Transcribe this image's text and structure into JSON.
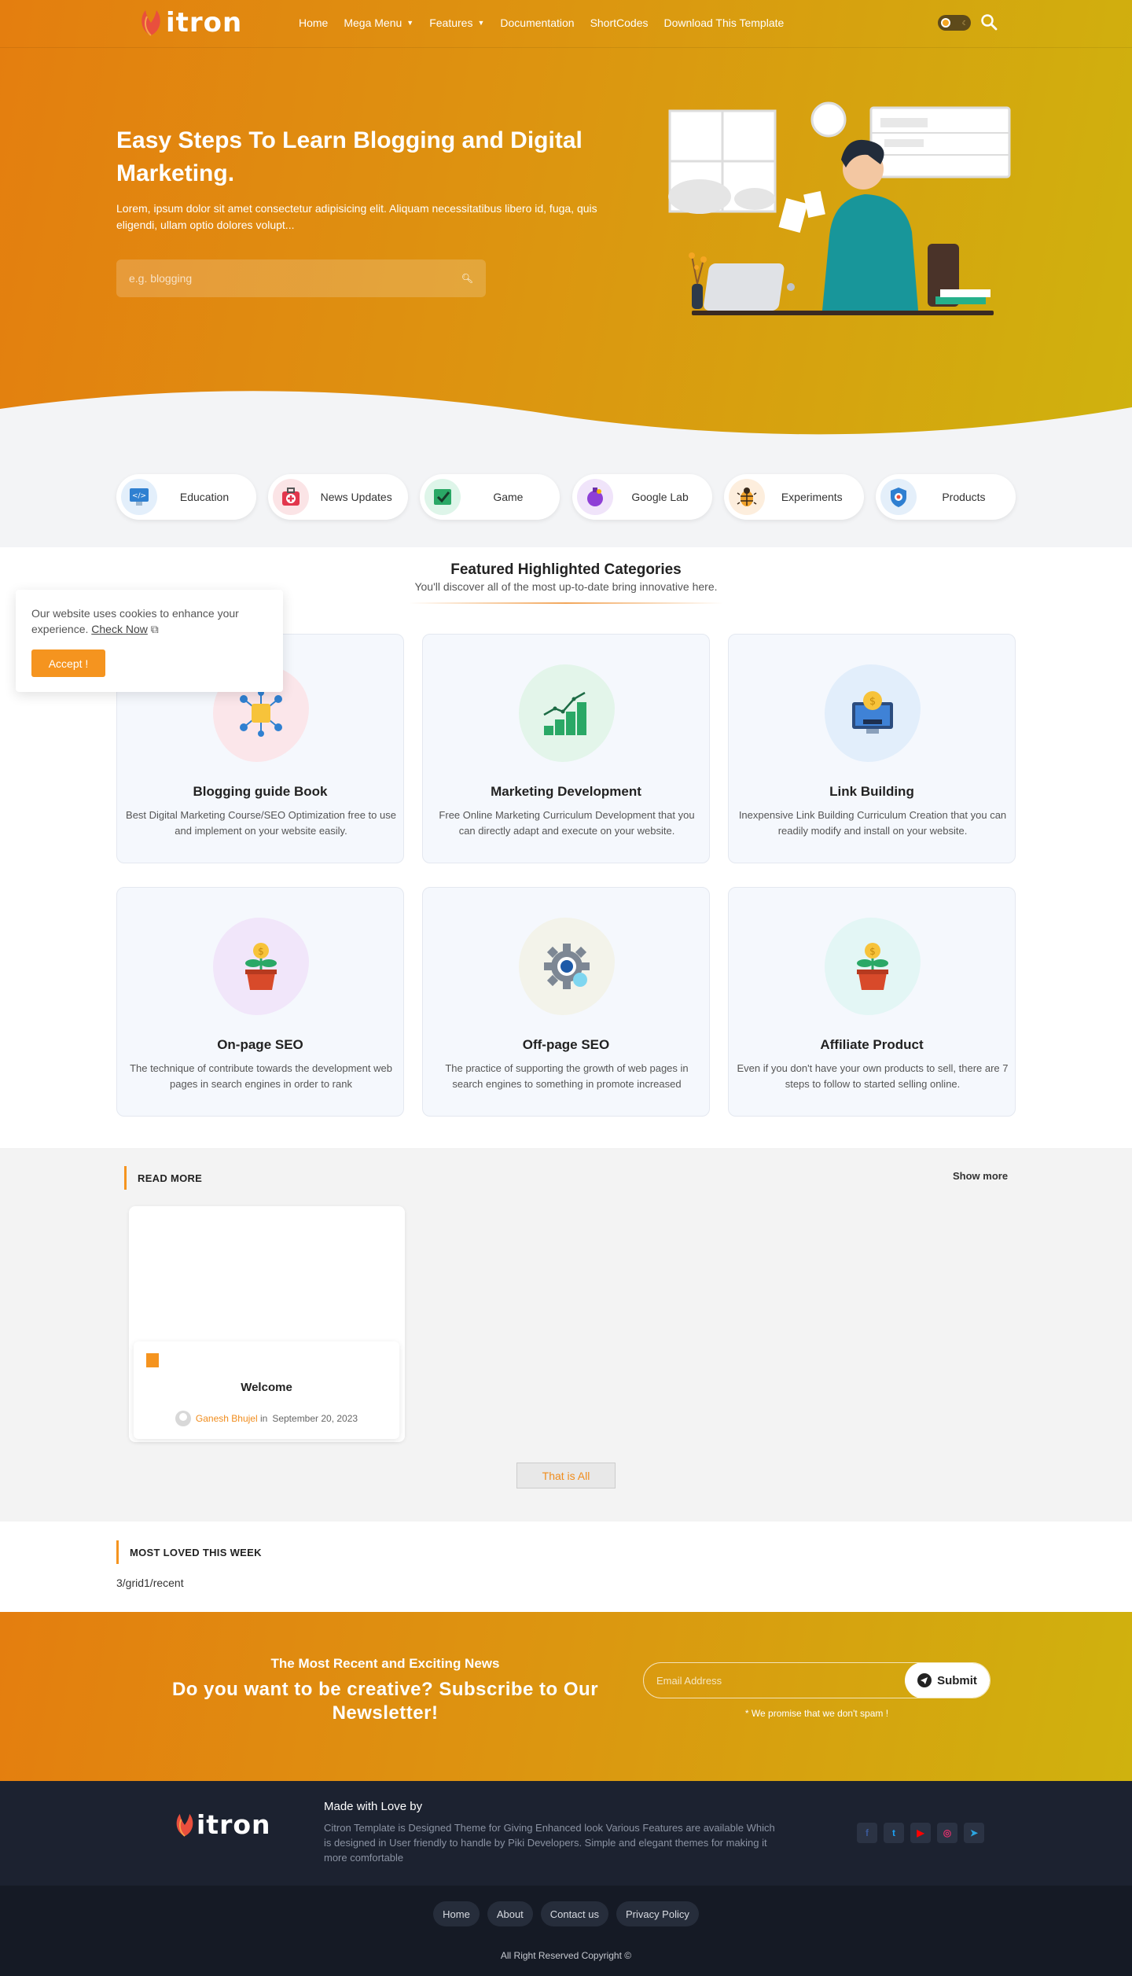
{
  "colors": {
    "accent": "#f5941f",
    "gradient_start": "#e47e0f",
    "gradient_end": "#cfb20e",
    "footer_bg": "#1c2230",
    "footer_bottom_bg": "#151a25"
  },
  "header": {
    "logo_text": "itron",
    "nav": [
      {
        "label": "Home"
      },
      {
        "label": "Mega Menu",
        "icon": "chevron-down-icon"
      },
      {
        "label": "Features",
        "icon": "chevron-down-icon"
      },
      {
        "label": "Documentation"
      },
      {
        "label": "ShortCodes"
      },
      {
        "label": "Download This Template"
      }
    ],
    "theme_toggle_icon": "sun-moon-toggle-icon",
    "search_icon": "search-icon"
  },
  "hero": {
    "title": "Easy Steps To Learn Blogging and Digital Marketing.",
    "description": "Lorem, ipsum dolor sit amet consectetur adipisicing elit. Aliquam necessitatibus libero id, fuga, quis eligendi, ullam optio dolores volupt...",
    "search_placeholder": "e.g. blogging",
    "search_icon": "search-icon"
  },
  "categories": [
    {
      "label": "Education",
      "icon": "code-monitor-icon"
    },
    {
      "label": "News Updates",
      "icon": "first-aid-kit-icon"
    },
    {
      "label": "Game",
      "icon": "checkbox-icon"
    },
    {
      "label": "Google Lab",
      "icon": "potion-flask-icon"
    },
    {
      "label": "Experiments",
      "icon": "bug-icon"
    },
    {
      "label": "Products",
      "icon": "shield-icon"
    }
  ],
  "featured": {
    "title": "Featured Highlighted Categories",
    "subtitle": "You'll discover all of the most up-to-date bring innovative here.",
    "cards": [
      {
        "title": "Blogging guide Book",
        "description": "Best Digital Marketing Course/SEO Optimization free to use and implement on your website easily.",
        "icon": "network-box-icon",
        "blob": "#fbe6ea"
      },
      {
        "title": "Marketing Development",
        "description": "Free Online Marketing Curriculum Development that you can directly adapt and execute on your website.",
        "icon": "growth-chart-icon",
        "blob": "#e3f5ea"
      },
      {
        "title": "Link Building",
        "description": "Inexpensive Link Building Curriculum Creation that you can readily modify and install on your website.",
        "icon": "money-monitor-icon",
        "blob": "#e2eefb"
      },
      {
        "title": "On-page SEO",
        "description": "The technique of contribute towards the development web pages in search engines in order to rank",
        "icon": "money-plant-icon",
        "blob": "#f1e6fa"
      },
      {
        "title": "Off-page SEO",
        "description": "The practice of supporting the growth of web pages in search engines to something in promote increased",
        "icon": "gear-search-icon",
        "blob": "#f3f3ea"
      },
      {
        "title": "Affiliate Product",
        "description": "Even if you don't have your own products to sell, there are 7 steps to follow to started selling online.",
        "icon": "money-plant-icon",
        "blob": "#e3f6f5"
      }
    ]
  },
  "cookie": {
    "text": "Our website uses cookies to enhance your experience.",
    "link": "Check Now",
    "button": "Accept !"
  },
  "read_more": {
    "heading": "READ MORE",
    "show_more": "Show more",
    "post": {
      "title": "Welcome",
      "author": "Ganesh Bhujel",
      "in": "in",
      "date": "September 20, 2023"
    },
    "end_label": "That is All"
  },
  "most_loved": {
    "heading": "MOST LOVED THIS WEEK",
    "content": "3/grid1/recent"
  },
  "newsletter": {
    "kicker": "The Most Recent and Exciting News",
    "title": "Do you want to be creative? Subscribe to Our Newsletter!",
    "email_placeholder": "Email Address",
    "submit": "Submit",
    "note": "* We promise that we don't spam !"
  },
  "footer": {
    "made_with": "Made with Love by",
    "description": "Citron Template is Designed Theme for Giving Enhanced look Various Features are available Which is designed in User friendly to handle by Piki Developers. Simple and elegant themes for making it more comfortable",
    "socials": [
      {
        "name": "facebook-icon",
        "glyph": "f",
        "color": "#3b5998"
      },
      {
        "name": "twitter-icon",
        "glyph": "t",
        "color": "#1da1f2"
      },
      {
        "name": "youtube-icon",
        "glyph": "▶",
        "color": "#ff0000"
      },
      {
        "name": "instagram-icon",
        "glyph": "◎",
        "color": "#e1306c"
      },
      {
        "name": "telegram-icon",
        "glyph": "➤",
        "color": "#2ca5e0"
      }
    ],
    "links": [
      "Home",
      "About",
      "Contact us",
      "Privacy Policy"
    ],
    "copyright": "All Right Reserved Copyright ©"
  }
}
